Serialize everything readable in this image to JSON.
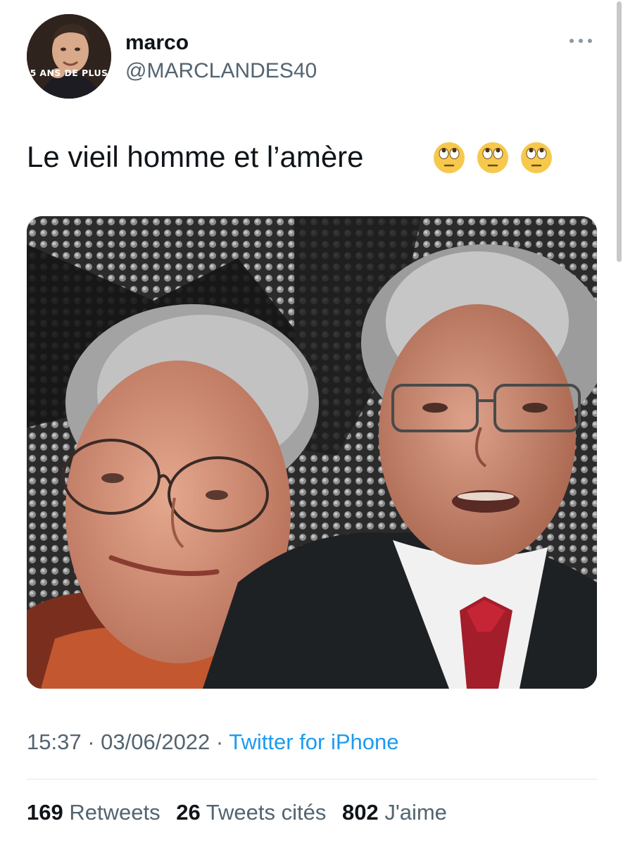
{
  "author": {
    "display_name": "marco",
    "handle": "@MARCLANDES40",
    "avatar_caption": "5 ANS DE PLUS"
  },
  "tweet": {
    "text": "Le vieil homme et l’amère",
    "emojis": [
      "face-with-rolling-eyes",
      "face-with-rolling-eyes",
      "face-with-rolling-eyes"
    ]
  },
  "meta": {
    "time": "15:37",
    "separator": " · ",
    "date": "03/06/2022",
    "source": "Twitter for iPhone"
  },
  "stats": {
    "retweets_count": "169",
    "retweets_label": "Retweets",
    "quotes_count": "26",
    "quotes_label": "Tweets cités",
    "likes_count": "802",
    "likes_label": "J'aime"
  },
  "colors": {
    "text": "#0f1419",
    "secondary": "#536471",
    "link": "#1d9bf0",
    "divider": "#e4e8eb"
  }
}
